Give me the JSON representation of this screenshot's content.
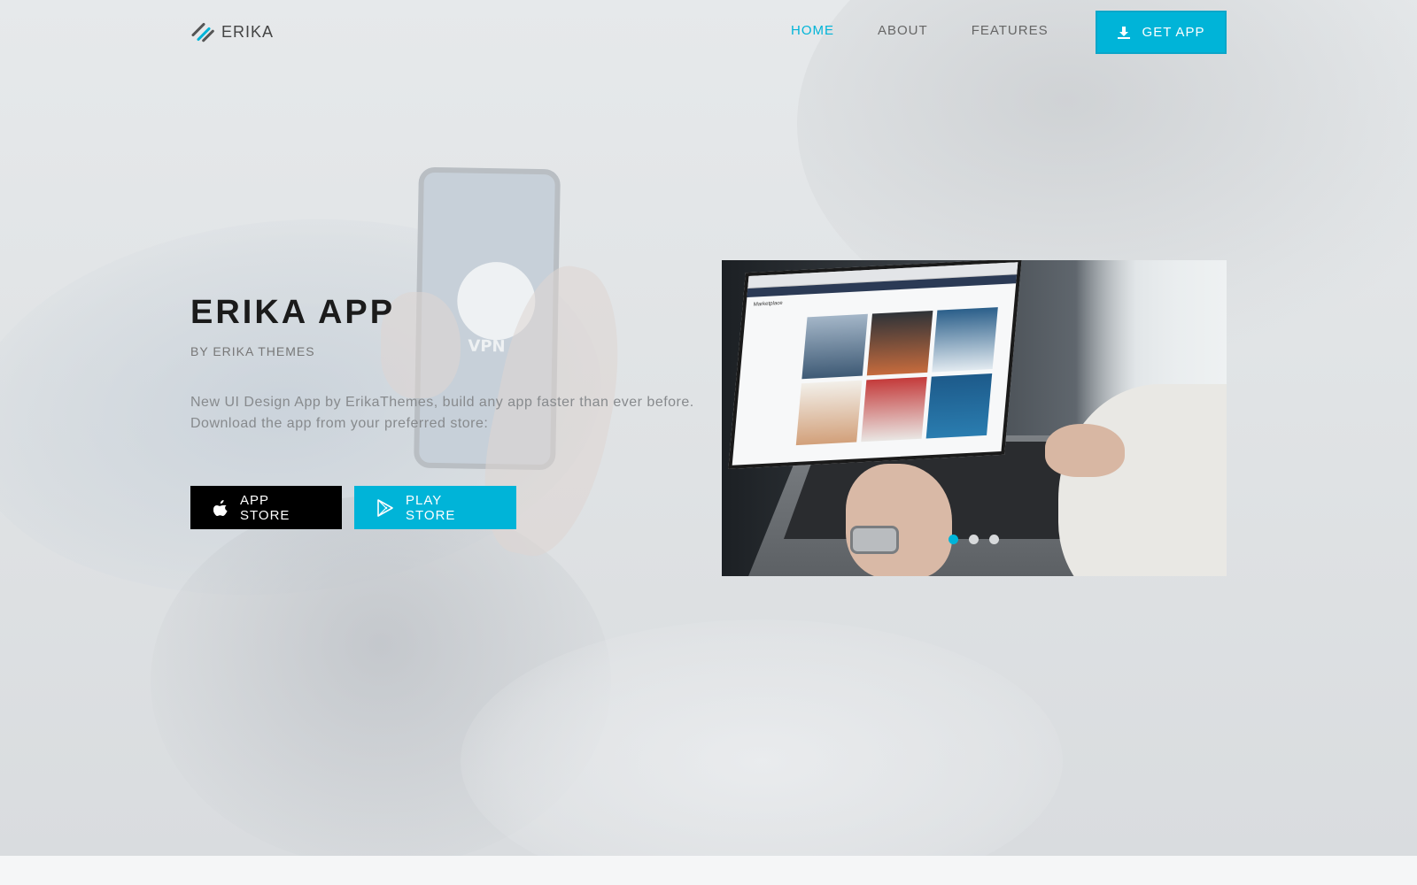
{
  "brand": {
    "name": "ERIKA",
    "accent": "#00b4d8"
  },
  "nav": {
    "links": [
      {
        "label": "HOME",
        "active": true
      },
      {
        "label": "ABOUT",
        "active": false
      },
      {
        "label": "FEATURES",
        "active": false
      }
    ],
    "cta": {
      "label": "GET APP",
      "icon": "download-icon"
    }
  },
  "hero": {
    "title": "ERIKA APP",
    "subtitle": "BY ERIKA THEMES",
    "description": "New UI Design App by ErikaThemes, build any app faster than ever before. Download the app from your preferred store:",
    "buttons": {
      "app_store": {
        "label": "APP STORE",
        "icon": "apple-icon",
        "color": "#000000"
      },
      "play_store": {
        "label": "PLAY STORE",
        "icon": "play-store-icon",
        "color": "#00b4d8"
      }
    },
    "background_phone_text": "VPN"
  },
  "carousel": {
    "screen_title": "Marketplace",
    "slide_count": 3,
    "active_slide": 1
  }
}
